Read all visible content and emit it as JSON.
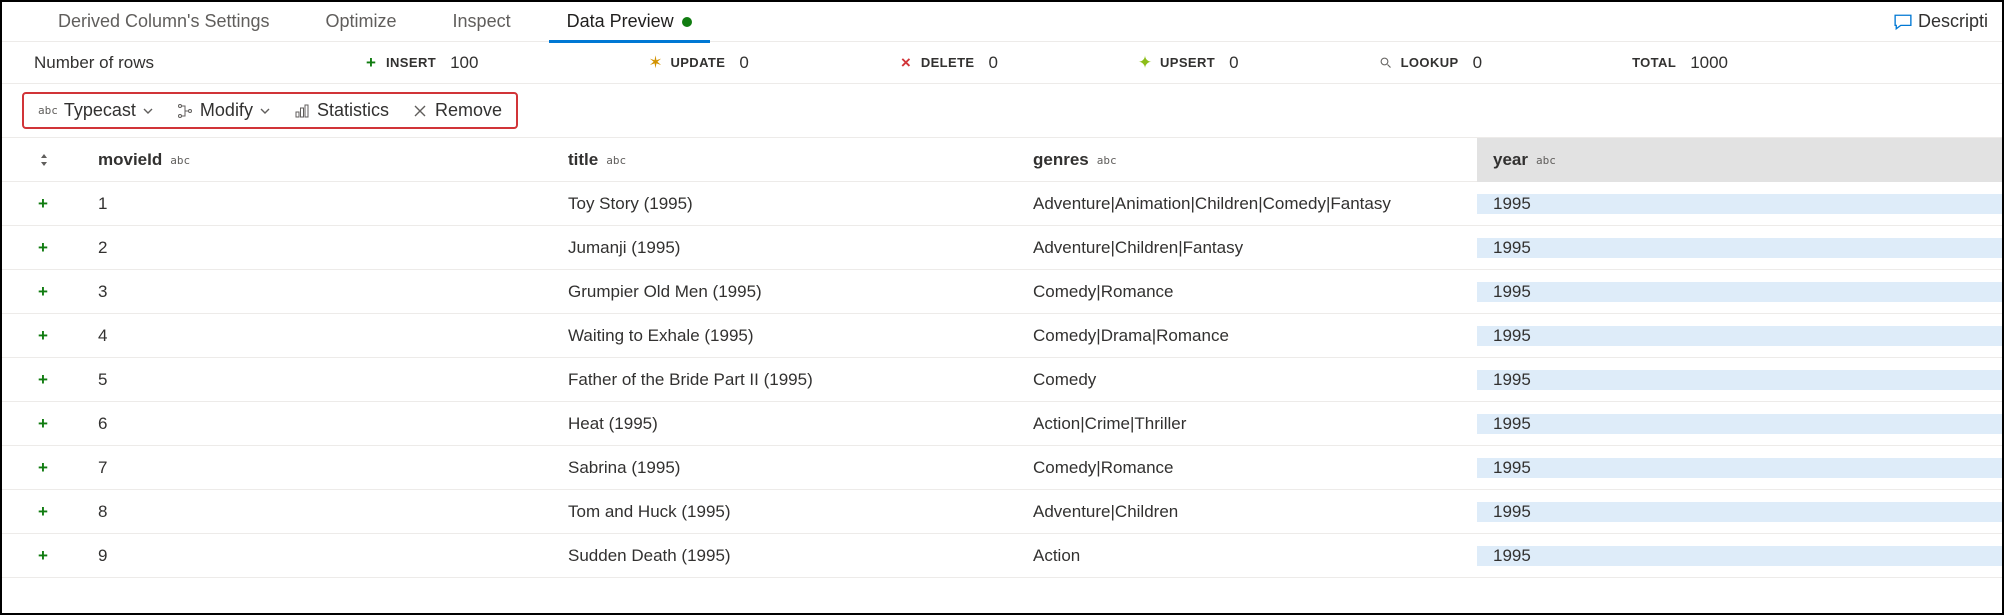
{
  "tabs": {
    "derived": "Derived Column's Settings",
    "optimize": "Optimize",
    "inspect": "Inspect",
    "dataPreview": "Data Preview"
  },
  "descriptionLabel": "Descripti",
  "rowsLabel": "Number of rows",
  "stats": {
    "insert": {
      "label": "INSERT",
      "value": "100"
    },
    "update": {
      "label": "UPDATE",
      "value": "0"
    },
    "delete": {
      "label": "DELETE",
      "value": "0"
    },
    "upsert": {
      "label": "UPSERT",
      "value": "0"
    },
    "lookup": {
      "label": "LOOKUP",
      "value": "0"
    },
    "total": {
      "label": "TOTAL",
      "value": "1000"
    }
  },
  "colToolbar": {
    "typecast": "Typecast",
    "modify": "Modify",
    "statistics": "Statistics",
    "remove": "Remove"
  },
  "columns": {
    "movieId": {
      "label": "movieId",
      "type": "abc"
    },
    "title": {
      "label": "title",
      "type": "abc"
    },
    "genres": {
      "label": "genres",
      "type": "abc"
    },
    "year": {
      "label": "year",
      "type": "abc"
    }
  },
  "rows": [
    {
      "movieId": "1",
      "title": "Toy Story (1995)",
      "genres": "Adventure|Animation|Children|Comedy|Fantasy",
      "year": "1995"
    },
    {
      "movieId": "2",
      "title": "Jumanji (1995)",
      "genres": "Adventure|Children|Fantasy",
      "year": "1995"
    },
    {
      "movieId": "3",
      "title": "Grumpier Old Men (1995)",
      "genres": "Comedy|Romance",
      "year": "1995"
    },
    {
      "movieId": "4",
      "title": "Waiting to Exhale (1995)",
      "genres": "Comedy|Drama|Romance",
      "year": "1995"
    },
    {
      "movieId": "5",
      "title": "Father of the Bride Part II (1995)",
      "genres": "Comedy",
      "year": "1995"
    },
    {
      "movieId": "6",
      "title": "Heat (1995)",
      "genres": "Action|Crime|Thriller",
      "year": "1995"
    },
    {
      "movieId": "7",
      "title": "Sabrina (1995)",
      "genres": "Comedy|Romance",
      "year": "1995"
    },
    {
      "movieId": "8",
      "title": "Tom and Huck (1995)",
      "genres": "Adventure|Children",
      "year": "1995"
    },
    {
      "movieId": "9",
      "title": "Sudden Death (1995)",
      "genres": "Action",
      "year": "1995"
    }
  ]
}
